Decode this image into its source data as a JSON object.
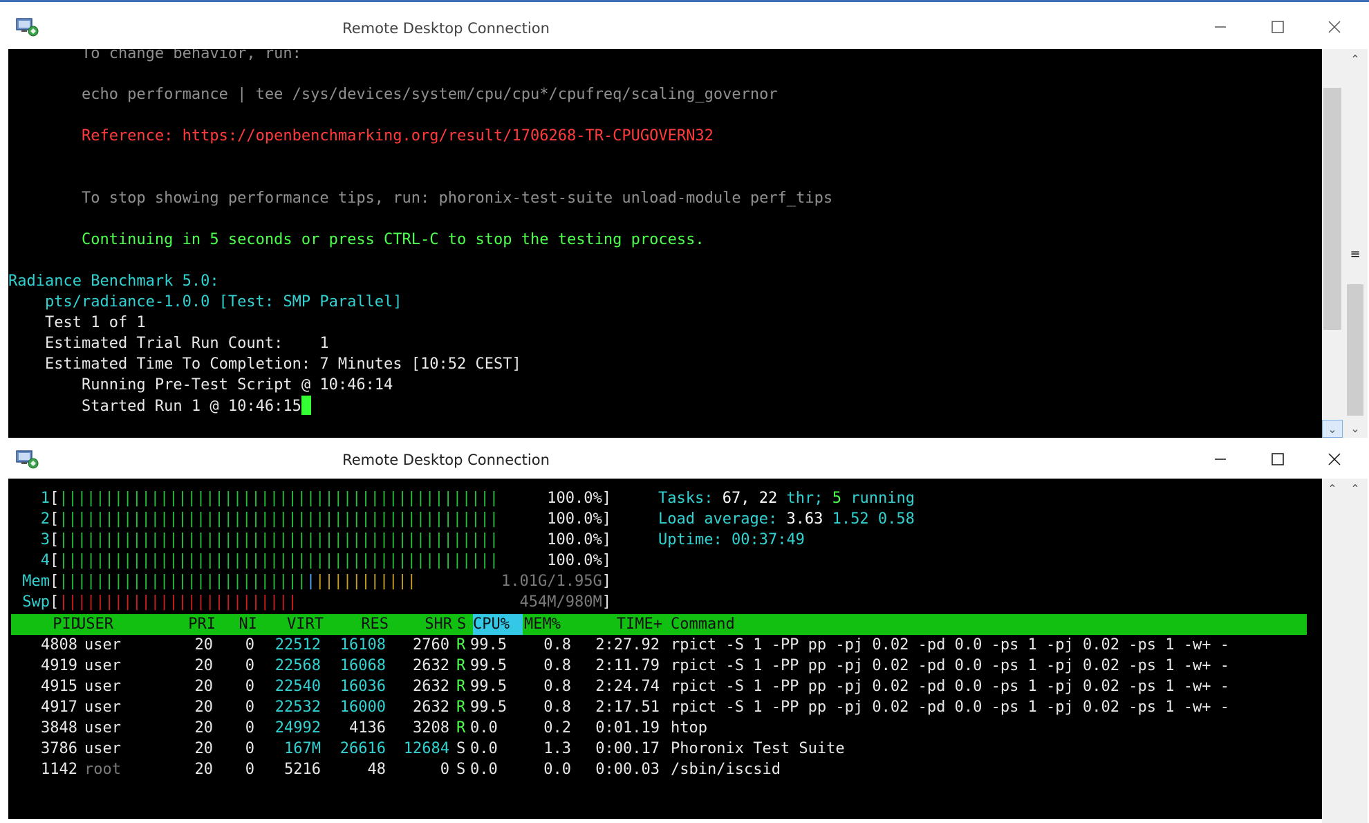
{
  "windows": {
    "top": {
      "title": "Remote Desktop Connection",
      "terminal_lines": [
        {
          "text": "        To change behavior, run:",
          "color": "dim"
        },
        {
          "text": "        echo performance | tee /sys/devices/system/cpu/cpu*/cpufreq/scaling_governor",
          "color": "dim"
        },
        {
          "text": "        Reference: https://openbenchmarking.org/result/1706268-TR-CPUGOVERN32",
          "color": "red"
        },
        {
          "text": "        To stop showing performance tips, run: phoronix-test-suite unload-module perf_tips",
          "color": "dim"
        },
        {
          "text": "        Continuing in 5 seconds or press CTRL-C to stop the testing process.",
          "color": "green"
        },
        {
          "text": "Radiance Benchmark 5.0:",
          "color": "cyan"
        },
        {
          "text": "    pts/radiance-1.0.0 [Test: SMP Parallel]",
          "color": "cyan"
        },
        {
          "text": "    Test 1 of 1",
          "color": "white"
        },
        {
          "text": "    Estimated Trial Run Count:    1",
          "color": "white"
        },
        {
          "text": "    Estimated Time To Completion: 7 Minutes [10:52 CEST]",
          "color": "white"
        },
        {
          "text": "        Running Pre-Test Script @ 10:46:14",
          "color": "white"
        },
        {
          "text": "        Started Run 1 @ 10:46:15",
          "color": "white"
        }
      ]
    },
    "bottom": {
      "title": "Remote Desktop Connection",
      "cpu_meters": [
        {
          "label": "1",
          "value": "100.0%"
        },
        {
          "label": "2",
          "value": "100.0%"
        },
        {
          "label": "3",
          "value": "100.0%"
        },
        {
          "label": "4",
          "value": "100.0%"
        }
      ],
      "mem_label": "Mem",
      "mem_value": "1.01G/1.95G",
      "swp_label": "Swp",
      "swp_value": "454M/980M",
      "summary": {
        "tasks_label": "Tasks:",
        "tasks_value": "67,",
        "thr_value": "22",
        "thr_label": "thr;",
        "running_value": "5",
        "running_label": "running",
        "load_label": "Load average:",
        "load_1": "3.63",
        "load_5": "1.52",
        "load_15": "0.58",
        "uptime_label": "Uptime:",
        "uptime_value": "00:37:49"
      },
      "columns": [
        "PID",
        "USER",
        "PRI",
        "NI",
        "VIRT",
        "RES",
        "SHR",
        "S",
        "CPU%",
        "MEM%",
        "TIME+",
        "Command"
      ],
      "processes": [
        {
          "pid": "4808",
          "user": "user",
          "pri": "20",
          "ni": "0",
          "virt": "22512",
          "res": "16108",
          "shr": "2760",
          "s": "R",
          "cpu": "99.5",
          "mem": "0.8",
          "time": "2:27.92",
          "cmd": "rpict -S 1 -PP pp -pj 0.02 -pd 0.0 -ps 1 -pj 0.02 -ps 1 -w+ -"
        },
        {
          "pid": "4919",
          "user": "user",
          "pri": "20",
          "ni": "0",
          "virt": "22568",
          "res": "16068",
          "shr": "2632",
          "s": "R",
          "cpu": "99.5",
          "mem": "0.8",
          "time": "2:11.79",
          "cmd": "rpict -S 1 -PP pp -pj 0.02 -pd 0.0 -ps 1 -pj 0.02 -ps 1 -w+ -"
        },
        {
          "pid": "4915",
          "user": "user",
          "pri": "20",
          "ni": "0",
          "virt": "22540",
          "res": "16036",
          "shr": "2632",
          "s": "R",
          "cpu": "99.5",
          "mem": "0.8",
          "time": "2:24.74",
          "cmd": "rpict -S 1 -PP pp -pj 0.02 -pd 0.0 -ps 1 -pj 0.02 -ps 1 -w+ -"
        },
        {
          "pid": "4917",
          "user": "user",
          "pri": "20",
          "ni": "0",
          "virt": "22532",
          "res": "16000",
          "shr": "2632",
          "s": "R",
          "cpu": "99.5",
          "mem": "0.8",
          "time": "2:17.51",
          "cmd": "rpict -S 1 -PP pp -pj 0.02 -pd 0.0 -ps 1 -pj 0.02 -ps 1 -w+ -"
        },
        {
          "pid": "3848",
          "user": "user",
          "pri": "20",
          "ni": "0",
          "virt": "24992",
          "res": "4136",
          "shr": "3208",
          "s": "R",
          "cpu": "0.0",
          "mem": "0.2",
          "time": "0:01.19",
          "cmd": "htop"
        },
        {
          "pid": "3786",
          "user": "user",
          "pri": "20",
          "ni": "0",
          "virt": "167M",
          "res": "26616",
          "shr": "12684",
          "s": "S",
          "cpu": "0.0",
          "mem": "1.3",
          "time": "0:00.17",
          "cmd": "Phoronix Test Suite"
        },
        {
          "pid": "1142",
          "user": "root",
          "pri": "20",
          "ni": "0",
          "virt": "5216",
          "res": "48",
          "shr": "0",
          "s": "S",
          "cpu": "0.0",
          "mem": "0.0",
          "time": "0:00.03",
          "cmd": "/sbin/iscsid"
        }
      ]
    }
  },
  "colors": {
    "terminal_bg": "#000000",
    "header_bar": "#12c012",
    "sorted_column": "#32c8e6",
    "cursor": "#33ff33"
  },
  "icons": [
    "remote-desktop-icon",
    "minimize-icon",
    "maximize-icon",
    "close-icon",
    "scroll-up-icon",
    "scroll-down-icon"
  ]
}
